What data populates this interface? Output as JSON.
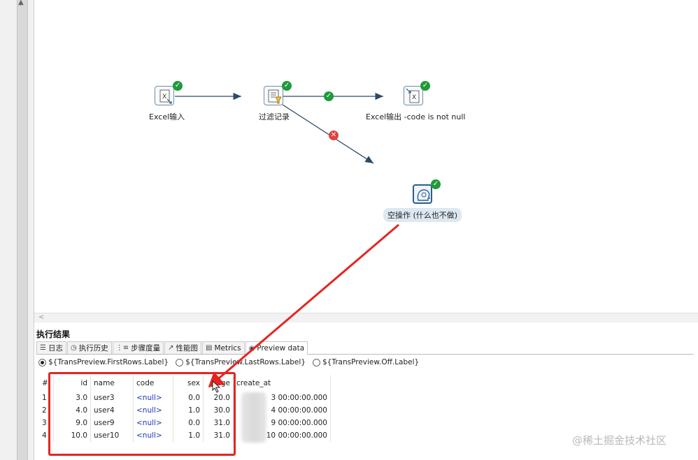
{
  "canvas": {
    "steps": [
      {
        "id": "excel-input",
        "label": "Excel输入",
        "status": "ok"
      },
      {
        "id": "filter",
        "label": "过滤记录",
        "status": "ok"
      },
      {
        "id": "excel-output",
        "label": "Excel输出 -code is not null",
        "status": "ok"
      },
      {
        "id": "dummy",
        "label": "空操作 (什么也不做)",
        "status": "ok"
      }
    ],
    "hops": [
      {
        "from": "excel-input",
        "to": "filter",
        "marker": ""
      },
      {
        "from": "filter",
        "to": "excel-output",
        "marker": "true"
      },
      {
        "from": "filter",
        "to": "dummy",
        "marker": "false"
      }
    ]
  },
  "results": {
    "title": "执行结果",
    "tabs": [
      {
        "label": "日志",
        "icon": "log-icon"
      },
      {
        "label": "执行历史",
        "icon": "history-icon"
      },
      {
        "label": "步骤度量",
        "icon": "step-metrics-icon"
      },
      {
        "label": "性能图",
        "icon": "performance-icon"
      },
      {
        "label": "Metrics",
        "icon": "metrics-icon"
      },
      {
        "label": "Preview data",
        "icon": "eye-icon",
        "active": true
      }
    ],
    "radios": [
      {
        "label": "${TransPreview.FirstRows.Label}",
        "checked": true
      },
      {
        "label": "${TransPreview.LastRows.Label}",
        "checked": false
      },
      {
        "label": "${TransPreview.Off.Label}",
        "checked": false
      }
    ],
    "columns": [
      "#",
      "id",
      "name",
      "code",
      "sex",
      "age",
      "create_at"
    ],
    "rows": [
      [
        "1",
        "3.0",
        "user3",
        "<null>",
        "0.0",
        "20.0",
        "3 00:00:00.000"
      ],
      [
        "2",
        "4.0",
        "user4",
        "<null>",
        "1.0",
        "30.0",
        "4 00:00:00.000"
      ],
      [
        "3",
        "9.0",
        "user9",
        "<null>",
        "0.0",
        "31.0",
        "9 00:00:00.000"
      ],
      [
        "4",
        "10.0",
        "user10",
        "<null>",
        "1.0",
        "31.0",
        "10 00:00:00.000"
      ]
    ]
  },
  "watermark": "@稀土掘金技术社区",
  "colors": {
    "ok": "#1e9b3a",
    "error": "#e0443e",
    "annotation": "#e52420",
    "hop": "#2c4a66"
  }
}
